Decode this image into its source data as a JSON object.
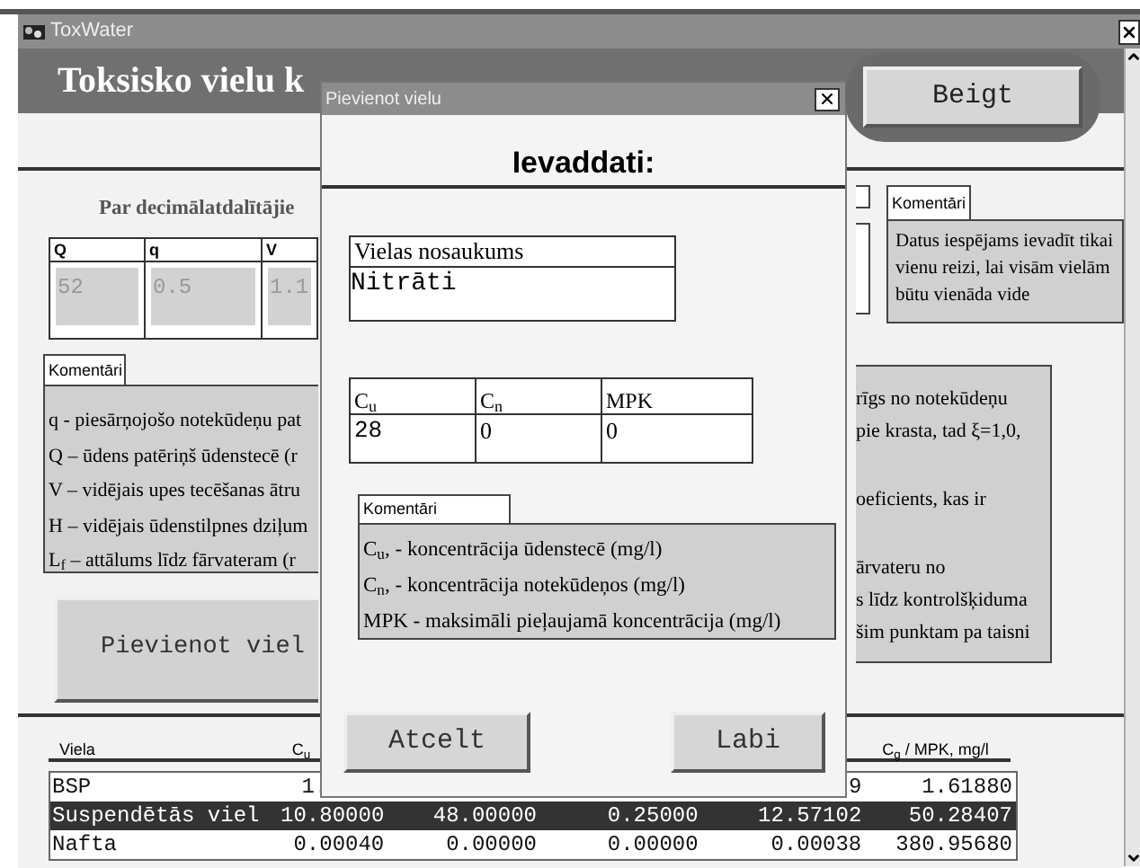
{
  "window": {
    "title": "ToxWater"
  },
  "header": {
    "title": "Toksisko vielu k",
    "exit_button": "Beigt"
  },
  "main": {
    "decimal_note": "Par decimālatdalītājie",
    "params_table": {
      "columns": [
        "Q",
        "q",
        "V"
      ],
      "values": [
        "52",
        "0.5",
        "1.1"
      ]
    },
    "comment_tab": "Komentāri",
    "comment_lines": [
      "q - piesārņojošo notekūdeņu pat",
      "Q – ūdens patēriņš ūdenstecē (r",
      "V – vidējais upes tecēšanas ātru",
      "H – vidējais ūdenstilpnes dziļum",
      "L$_{f}$ – attālums līdz fārvateram (r"
    ],
    "add_button": "Pievienot viel",
    "side_comment_tab": "Komentāri",
    "side_comment": "Datus iespējams ievadīt tikai vienu reizi, lai visām vielām būtu vienāda vide",
    "right_comment_groups": [
      [
        "rīgs no notekūdeņu",
        "pie krasta, tad ξ=1,0,"
      ],
      [
        "oeficients, kas ir"
      ],
      [
        "ārvateru no",
        "s līdz kontrolšķiduma",
        "šim punktam pa taisni"
      ]
    ]
  },
  "table": {
    "columns": [
      {
        "kind": "label",
        "text": "Viela"
      },
      {
        "kind": "label",
        "text": "C$_{u}$"
      },
      {
        "kind": "empty"
      },
      {
        "kind": "empty"
      },
      {
        "kind": "empty"
      },
      {
        "kind": "label",
        "text": "C$_{g}$ / MPK, mg/l"
      }
    ],
    "rows": [
      {
        "selected": false,
        "cells": [
          {
            "kind": "name",
            "text": "BSP"
          },
          {
            "kind": "head",
            "text": "1."
          },
          {
            "kind": "empty"
          },
          {
            "kind": "empty"
          },
          {
            "kind": "tail",
            "text": "9"
          },
          {
            "kind": "number",
            "text": "1.61880"
          }
        ]
      },
      {
        "selected": true,
        "cells": [
          {
            "kind": "name",
            "text": "Suspendētās viel"
          },
          {
            "kind": "number",
            "text": "10.80000"
          },
          {
            "kind": "number",
            "text": "48.00000"
          },
          {
            "kind": "number",
            "text": "0.25000"
          },
          {
            "kind": "number",
            "text": "12.57102"
          },
          {
            "kind": "number",
            "text": "50.28407"
          }
        ]
      },
      {
        "selected": false,
        "cells": [
          {
            "kind": "name",
            "text": "Nafta"
          },
          {
            "kind": "number",
            "text": "0.00040"
          },
          {
            "kind": "number",
            "text": "0.00000"
          },
          {
            "kind": "number",
            "text": "0.00000"
          },
          {
            "kind": "number",
            "text": "0.00038"
          },
          {
            "kind": "number",
            "text": "380.95680"
          }
        ]
      }
    ]
  },
  "dialog": {
    "title": "Pievienot vielu",
    "heading": "Ievaddati:",
    "name_field": {
      "label": "Vielas nosaukums",
      "value": "Nitrāti"
    },
    "values_table": {
      "columns": [
        "C$_{u}$",
        "C$_{n}$",
        "MPK"
      ],
      "values": [
        "28",
        "0",
        "0"
      ]
    },
    "comment_tab": "Komentāri",
    "comment_lines": [
      "C$_{u}$, - koncentrācija ūdenstecē (mg/l)",
      "C$_{n}$, - koncentrācija notekūdeņos (mg/l)",
      "MPK - maksimāli pieļaujamā koncentrācija (mg/l)"
    ],
    "cancel_button": "Atcelt",
    "ok_button": "Labi"
  }
}
